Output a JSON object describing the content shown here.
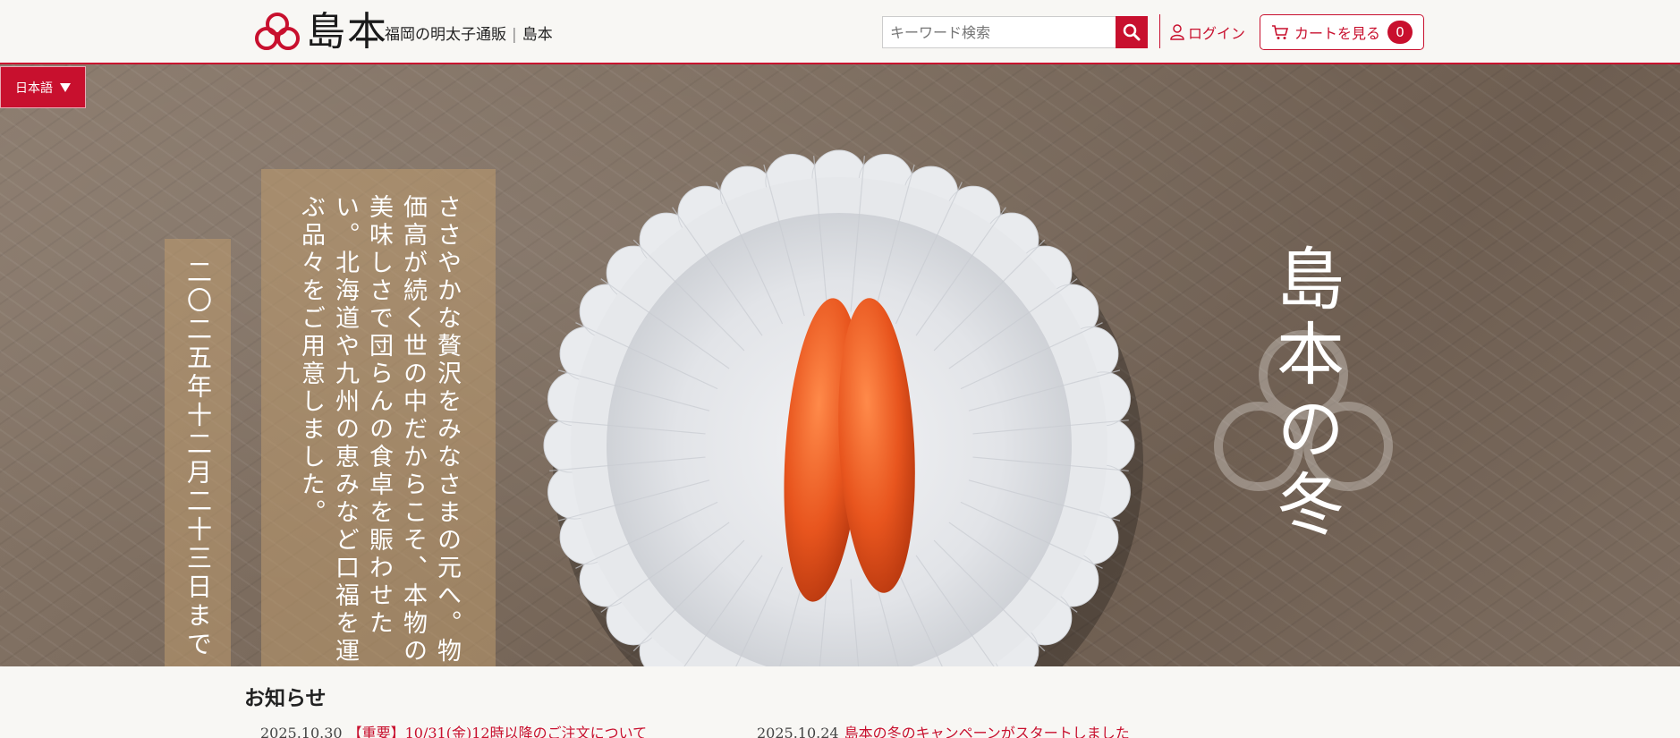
{
  "header": {
    "brand": "島本",
    "tagline_main": "福岡の明太子通販",
    "tagline_sep": "|",
    "tagline_brand": "島本",
    "search_placeholder": "キーワード検索",
    "login_label": "ログイン",
    "cart_label": "カートを見る",
    "cart_count": "0"
  },
  "language": {
    "selected": "日本語"
  },
  "hero": {
    "date_text": "二〇二五年十二月二十三日まで",
    "copy_text": "ささやかな贅沢をみなさまの元へ。物価高が続く世の中だからこそ、本物の美味しさで団らんの食卓を賑わせたい。北海道や九州の恵みなど口福を運ぶ品々をご用意しました。",
    "title": "島本の冬"
  },
  "news": {
    "heading": "お知らせ",
    "items": [
      {
        "date": "2025.10.30",
        "title": "【重要】10/31(金)12時以降のご注文について"
      },
      {
        "date": "2025.10.24",
        "title": "島本の冬のキャンペーンがスタートしました"
      }
    ]
  },
  "colors": {
    "accent": "#c8102e",
    "hero_bg": "#7a6a5c"
  }
}
